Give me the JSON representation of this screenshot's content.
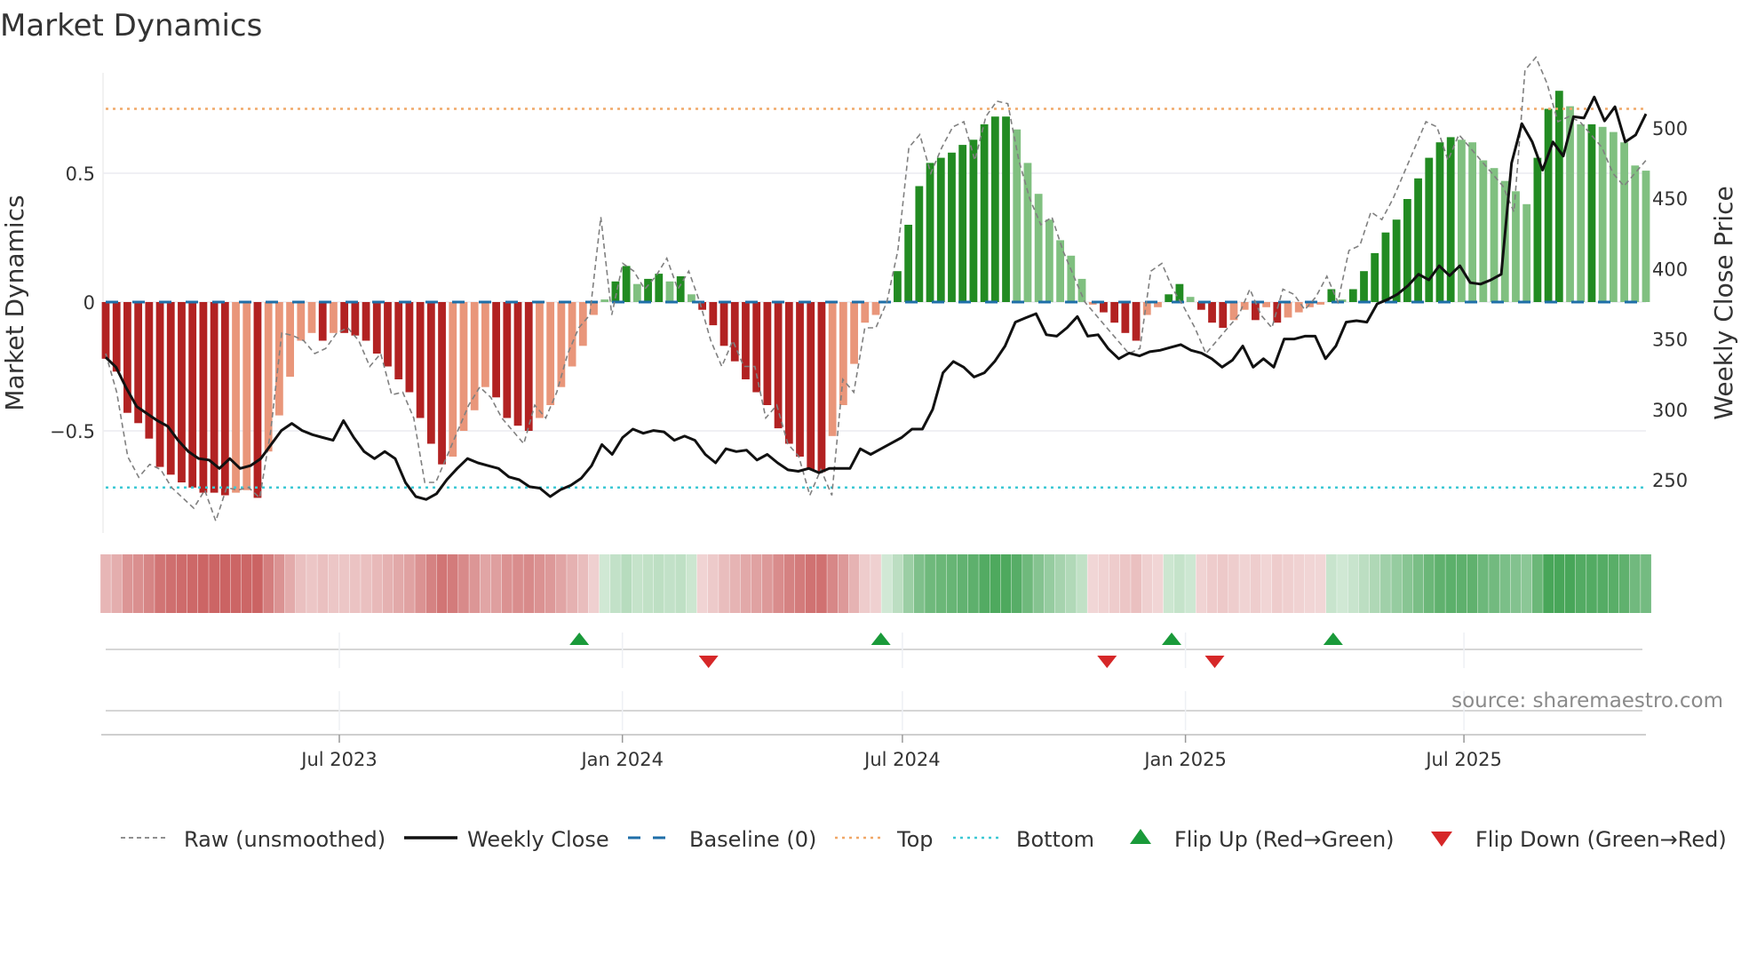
{
  "title": "Market Dynamics",
  "source": "source: sharemaestro.com",
  "chart_data": {
    "type": "bar",
    "title": "Market Dynamics",
    "ylabel": "Market Dynamics",
    "y2label": "Weekly Close Price",
    "ylim": [
      -0.9,
      0.88
    ],
    "y2lim": [
      214,
      538
    ],
    "yticks": [
      {
        "v": 0.5,
        "label": "0.5"
      },
      {
        "v": 0,
        "label": "0"
      },
      {
        "v": -0.5,
        "label": "−0.5"
      }
    ],
    "y2ticks": [
      {
        "v": 500,
        "label": "500"
      },
      {
        "v": 450,
        "label": "450"
      },
      {
        "v": 400,
        "label": "400"
      },
      {
        "v": 350,
        "label": "350"
      },
      {
        "v": 300,
        "label": "300"
      },
      {
        "v": 250,
        "label": "250"
      }
    ],
    "xticks": [
      {
        "date": "2023-07-01",
        "label": "Jul 2023"
      },
      {
        "date": "2024-01-01",
        "label": "Jan 2024"
      },
      {
        "date": "2024-07-01",
        "label": "Jul 2024"
      },
      {
        "date": "2025-01-01",
        "label": "Jan 2025"
      },
      {
        "date": "2025-07-01",
        "label": "Jul 2025"
      }
    ],
    "start_date": "2023-01-30",
    "end_date": "2025-10-27",
    "frequency": "weekly",
    "top_level": 0.75,
    "bottom_level": -0.72,
    "baseline": 0,
    "smoothed": [
      -0.22,
      -0.27,
      -0.43,
      -0.47,
      -0.53,
      -0.64,
      -0.67,
      -0.7,
      -0.72,
      -0.74,
      -0.74,
      -0.75,
      -0.74,
      -0.73,
      -0.76,
      -0.58,
      -0.44,
      -0.29,
      -0.15,
      -0.12,
      -0.15,
      -0.12,
      -0.12,
      -0.13,
      -0.15,
      -0.2,
      -0.25,
      -0.3,
      -0.35,
      -0.45,
      -0.55,
      -0.63,
      -0.6,
      -0.5,
      -0.42,
      -0.33,
      -0.37,
      -0.45,
      -0.48,
      -0.5,
      -0.45,
      -0.4,
      -0.33,
      -0.25,
      -0.17,
      -0.05,
      0.01,
      0.08,
      0.14,
      0.07,
      0.09,
      0.11,
      0.08,
      0.1,
      0.03,
      -0.03,
      -0.09,
      -0.17,
      -0.23,
      -0.3,
      -0.35,
      -0.4,
      -0.49,
      -0.55,
      -0.6,
      -0.65,
      -0.66,
      -0.52,
      -0.4,
      -0.24,
      -0.08,
      -0.05,
      0.005,
      0.12,
      0.3,
      0.45,
      0.54,
      0.56,
      0.58,
      0.61,
      0.63,
      0.69,
      0.72,
      0.72,
      0.67,
      0.54,
      0.42,
      0.32,
      0.24,
      0.18,
      0.09,
      -0.01,
      -0.04,
      -0.08,
      -0.12,
      -0.15,
      -0.05,
      -0.02,
      0.03,
      0.07,
      0.02,
      -0.03,
      -0.08,
      -0.1,
      -0.07,
      -0.03,
      -0.07,
      -0.02,
      -0.08,
      -0.06,
      -0.04,
      -0.02,
      -0.01,
      0.05,
      0.01,
      0.05,
      0.12,
      0.19,
      0.27,
      0.32,
      0.4,
      0.48,
      0.56,
      0.62,
      0.64,
      0.63,
      0.62,
      0.55,
      0.52,
      0.47,
      0.43,
      0.38,
      0.56,
      0.75,
      0.82,
      0.76,
      0.69,
      0.69,
      0.68,
      0.66,
      0.62,
      0.53,
      0.51
    ],
    "raw": [
      -0.2,
      -0.35,
      -0.6,
      -0.68,
      -0.63,
      -0.65,
      -0.72,
      -0.76,
      -0.8,
      -0.73,
      -0.85,
      -0.72,
      -0.73,
      -0.72,
      -0.76,
      -0.5,
      -0.12,
      -0.13,
      -0.15,
      -0.2,
      -0.18,
      -0.12,
      -0.1,
      -0.15,
      -0.25,
      -0.2,
      -0.36,
      -0.35,
      -0.45,
      -0.7,
      -0.7,
      -0.6,
      -0.5,
      -0.4,
      -0.33,
      -0.37,
      -0.45,
      -0.5,
      -0.55,
      -0.4,
      -0.45,
      -0.35,
      -0.2,
      -0.1,
      -0.05,
      0.33,
      -0.05,
      0.15,
      0.12,
      0.05,
      0.1,
      0.17,
      0.05,
      0.12,
      0.0,
      -0.15,
      -0.25,
      -0.15,
      -0.25,
      -0.25,
      -0.45,
      -0.4,
      -0.55,
      -0.6,
      -0.75,
      -0.65,
      -0.75,
      -0.3,
      -0.35,
      -0.1,
      -0.1,
      0.0,
      0.2,
      0.6,
      0.65,
      0.5,
      0.6,
      0.68,
      0.7,
      0.55,
      0.72,
      0.78,
      0.77,
      0.55,
      0.4,
      0.3,
      0.33,
      0.2,
      0.1,
      0.0,
      -0.05,
      -0.1,
      -0.15,
      -0.2,
      -0.18,
      0.12,
      0.15,
      0.05,
      -0.02,
      -0.1,
      -0.2,
      -0.15,
      -0.1,
      -0.05,
      0.05,
      -0.05,
      -0.1,
      0.05,
      0.03,
      -0.03,
      0.02,
      0.1,
      0.0,
      0.2,
      0.22,
      0.35,
      0.32,
      0.4,
      0.5,
      0.6,
      0.7,
      0.68,
      0.55,
      0.65,
      0.6,
      0.55,
      0.5,
      0.45,
      0.35,
      0.9,
      0.95,
      0.85,
      0.7,
      0.72,
      0.7,
      0.65,
      0.6,
      0.5,
      0.45,
      0.5,
      0.55
    ],
    "close": [
      337,
      330,
      315,
      302,
      297,
      292,
      288,
      278,
      270,
      265,
      264,
      258,
      265,
      258,
      260,
      265,
      275,
      285,
      290,
      285,
      282,
      280,
      278,
      292,
      280,
      270,
      265,
      270,
      265,
      248,
      238,
      236,
      240,
      250,
      258,
      265,
      262,
      260,
      258,
      252,
      250,
      245,
      244,
      238,
      243,
      246,
      251,
      260,
      275,
      268,
      280,
      286,
      283,
      285,
      284,
      278,
      281,
      278,
      268,
      262,
      272,
      270,
      271,
      264,
      268,
      262,
      257,
      256,
      258,
      255,
      258,
      258,
      258,
      272,
      268,
      272,
      276,
      280,
      286,
      286,
      300,
      326,
      334,
      330,
      323,
      326,
      334,
      345,
      362,
      365,
      368,
      353,
      352,
      358,
      366,
      352,
      353,
      343,
      336,
      340,
      338,
      341,
      342,
      344,
      346,
      342,
      340,
      336,
      330,
      335,
      345,
      330,
      336,
      330,
      350,
      350,
      352,
      352,
      336,
      345,
      362,
      363,
      362,
      375,
      378,
      382,
      388,
      396,
      392,
      402,
      395,
      402,
      390,
      389,
      392,
      396,
      475,
      503,
      490,
      470,
      490,
      480,
      508,
      507,
      522,
      505,
      515,
      490,
      495,
      510
    ],
    "flip_up": [
      "2023-12-04",
      "2024-06-17",
      "2024-12-23",
      "2025-04-07"
    ],
    "flip_down": [
      "2024-02-26",
      "2024-11-11",
      "2025-01-20"
    ],
    "colors": {
      "dark_red": "#b22222",
      "light_red": "#e9967a",
      "dark_green": "#228b22",
      "light_green": "#80c080",
      "top": "#f0a868",
      "bottom": "#3cc8d4",
      "baseline": "#1f6fa8",
      "raw": "#808080",
      "close": "#111111",
      "flip_up": "#1a9a3a",
      "flip_down": "#d62728"
    },
    "legend": {
      "position": "bottom",
      "items": [
        "Raw (unsmoothed)",
        "Weekly Close",
        "Baseline (0)",
        "Top",
        "Bottom",
        "Flip Up (Red→Green)",
        "Flip Down (Green→Red)"
      ]
    },
    "grid": true
  }
}
